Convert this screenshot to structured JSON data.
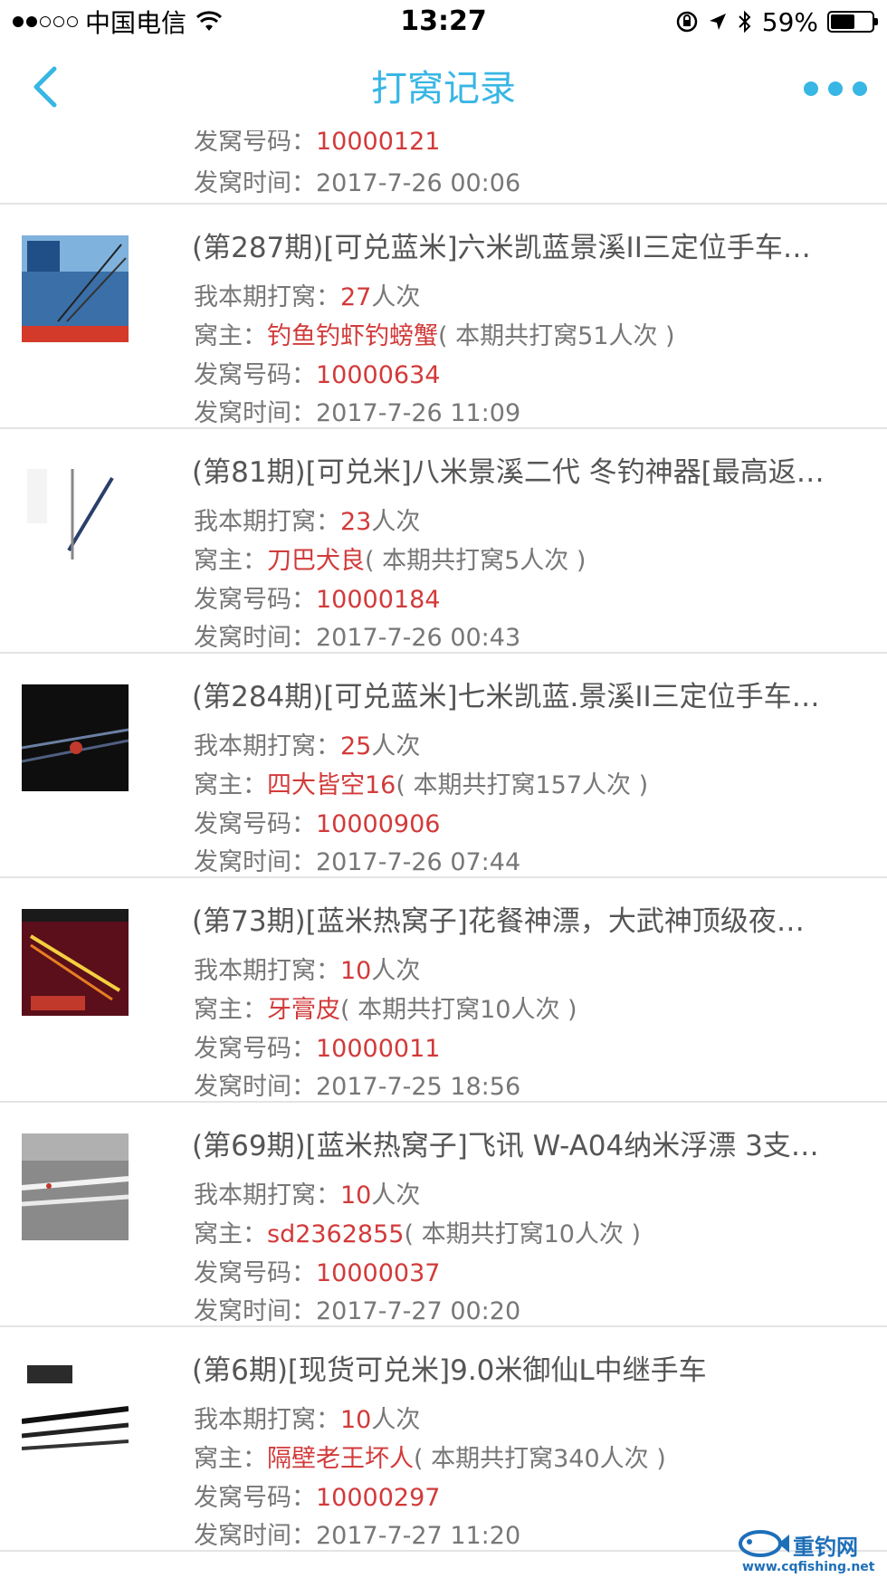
{
  "status_bar": {
    "carrier": "中国电信",
    "time": "13:27",
    "battery": "59%",
    "battery_level": 0.59
  },
  "nav": {
    "title": "打窝记录"
  },
  "labels": {
    "my_count": "我本期打窝：",
    "times_suffix": "人次",
    "owner": "窝主：",
    "code": "发窝号码：",
    "time": "发窝时间："
  },
  "partial_record": {
    "code": "10000121",
    "time": "2017-7-26 00:06"
  },
  "records": [
    {
      "title": "(第287期)[可兑蓝米]六米凯蓝景溪II三定位手车…",
      "my_count": "27",
      "owner": "钓鱼钓虾钓螃蟹",
      "owner_total": "( 本期共打窝51人次 )",
      "code": "10000634",
      "time": "2017-7-26 11:09",
      "thumb_icon": "fishing-rod-product-image"
    },
    {
      "title": "(第81期)[可兑米]八米景溪二代 冬钓神器[最高返…",
      "my_count": "23",
      "owner": "刀巴犬良",
      "owner_total": "( 本期共打窝5人次 )",
      "code": "10000184",
      "time": "2017-7-26 00:43",
      "thumb_icon": "fishing-rod-product-image"
    },
    {
      "title": "(第284期)[可兑蓝米]七米凯蓝.景溪II三定位手车…",
      "my_count": "25",
      "owner": "四大皆空16",
      "owner_total": "( 本期共打窝157人次 )",
      "code": "10000906",
      "time": "2017-7-26 07:44",
      "thumb_icon": "fishing-rod-product-image"
    },
    {
      "title": "(第73期)[蓝米热窝子]花餐神漂，大武神顶级夜…",
      "my_count": "10",
      "owner": "牙膏皮",
      "owner_total": "( 本期共打窝10人次 )",
      "code": "10000011",
      "time": "2017-7-25 18:56",
      "thumb_icon": "fishing-float-product-image"
    },
    {
      "title": "(第69期)[蓝米热窝子]飞讯 W-A04纳米浮漂 3支…",
      "my_count": "10",
      "owner": "sd2362855",
      "owner_total": "( 本期共打窝10人次 )",
      "code": "10000037",
      "time": "2017-7-27 00:20",
      "thumb_icon": "fishing-float-product-image"
    },
    {
      "title": "(第6期)[现货可兑米]9.0米御仙L中继手车",
      "my_count": "10",
      "owner": "隔壁老王坏人",
      "owner_total": "( 本期共打窝340人次 )",
      "code": "10000297",
      "time": "2017-7-27 11:20",
      "thumb_icon": "fishing-rod-product-image"
    }
  ],
  "watermark": {
    "brand": "重钓网",
    "url": "www.cqfishing.net"
  },
  "colors": {
    "accent": "#38b6e4",
    "highlight": "#d23a3a",
    "text": "#777777",
    "divider": "#e4e4e4"
  }
}
